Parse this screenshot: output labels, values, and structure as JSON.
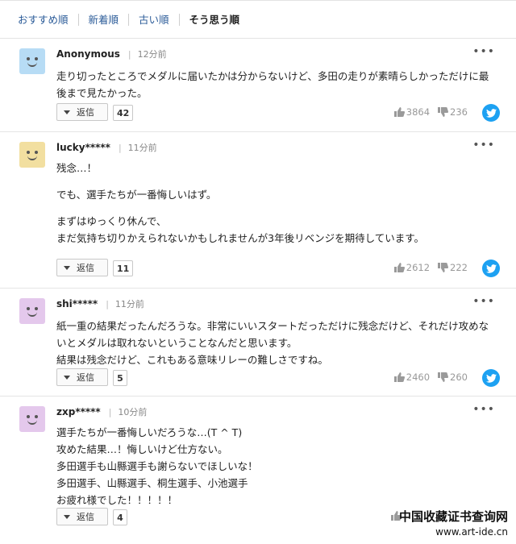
{
  "sort_tabs": [
    "おすすめ順",
    "新着順",
    "古い順",
    "そう思う順"
  ],
  "reply_label": "返信",
  "comments": [
    {
      "author": "Anonymous",
      "time": "12分前",
      "avatar_color": "#b7dcf5",
      "lines": [
        "走り切ったところでメダルに届いたかは分からないけど、多田の走りが素晴らしかっただけに最",
        "後まで見たかった。"
      ],
      "replies": "42",
      "likes": "3864",
      "dislikes": "236"
    },
    {
      "author": "lucky*****",
      "time": "11分前",
      "avatar_color": "#f2dfa0",
      "lines": [
        "残念…！",
        "",
        "でも、選手たちが一番悔しいはず。",
        "",
        "まずはゆっくり休んで、",
        "まだ気持ち切りかえられないかもしれませんが3年後リベンジを期待しています。"
      ],
      "replies": "11",
      "likes": "2612",
      "dislikes": "222"
    },
    {
      "author": "shi*****",
      "time": "11分前",
      "avatar_color": "#e4c8ec",
      "lines": [
        "紙一重の結果だったんだろうな。非常にいいスタートだっただけに残念だけど、それだけ攻めな",
        "いとメダルは取れないということなんだと思います。",
        "結果は残念だけど、これもある意味リレーの難しさですね。"
      ],
      "replies": "5",
      "likes": "2460",
      "dislikes": "260"
    },
    {
      "author": "zxp*****",
      "time": "10分前",
      "avatar_color": "#e4c8ec",
      "lines": [
        "選手たちが一番悔しいだろうな…(T ^ T)",
        "攻めた結果…！悔しいけど仕方ない。",
        "多田選手も山縣選手も謝らないでほしいな！",
        "多田選手、山縣選手、桐生選手、小池選手",
        "お疲れ様でした！！！！！"
      ],
      "replies": "4",
      "likes": "",
      "dislikes": ""
    }
  ],
  "watermark": {
    "line1": "中国收藏证书查询网",
    "line2": "www.art-ide.cn"
  },
  "colors": {
    "link": "#2c5c99",
    "twitter": "#1da1f2"
  },
  "icons": [
    "thumbs-up-icon",
    "thumbs-down-icon",
    "twitter-icon",
    "more-options-icon",
    "dropdown-triangle-icon"
  ]
}
